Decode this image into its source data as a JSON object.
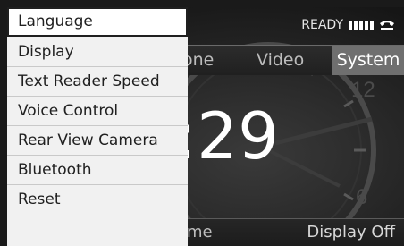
{
  "status": {
    "ready_text": "READY",
    "signal_bars": 5,
    "phone_icon": "phone-handset-icon"
  },
  "tabs": [
    {
      "label": "one",
      "selected": false
    },
    {
      "label": "Video",
      "selected": false
    },
    {
      "label": "System",
      "selected": true
    }
  ],
  "main": {
    "time": ":29",
    "clock_numerals": [
      "12",
      "6"
    ]
  },
  "bottom": {
    "left_label": "ime",
    "right_label": "Display Off"
  },
  "menu": {
    "selected_index": 0,
    "items": [
      {
        "label": "Language"
      },
      {
        "label": "Display"
      },
      {
        "label": "Text Reader Speed"
      },
      {
        "label": "Voice Control"
      },
      {
        "label": "Rear View Camera"
      },
      {
        "label": "Bluetooth"
      },
      {
        "label": "Reset"
      }
    ]
  },
  "colors": {
    "menu_background": "#f1f1f1",
    "selected_tab": "#6f6f6f",
    "text_light": "#ffffff"
  }
}
